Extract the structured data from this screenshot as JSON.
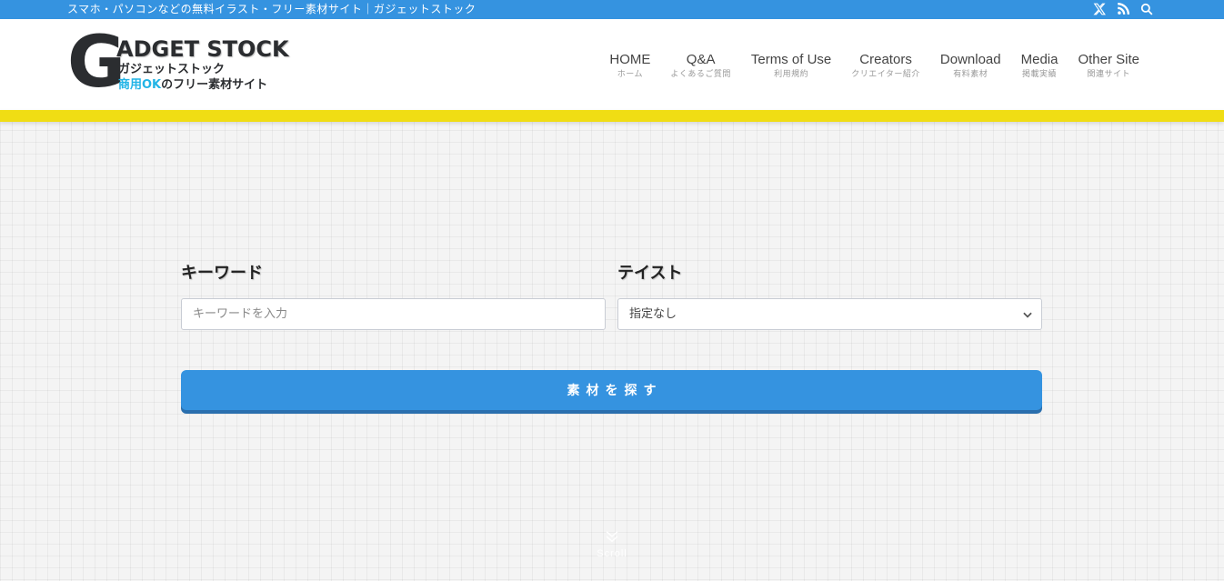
{
  "topbar": {
    "tagline": "スマホ・パソコンなどの無料イラスト・フリー素材サイト｜ガジェットストック",
    "icons": [
      "x-twitter-icon",
      "rss-icon",
      "search-icon"
    ]
  },
  "logo": {
    "initial": "G",
    "brand": "ADGET STOCK",
    "kana": "ガジェットストック",
    "sub_accent": "商用OK",
    "sub_rest": "のフリー素材サイト"
  },
  "nav": {
    "items": [
      {
        "en": "HOME",
        "ja": "ホーム"
      },
      {
        "en": "Q&A",
        "ja": "よくあるご質問"
      },
      {
        "en": "Terms of Use",
        "ja": "利用規約"
      },
      {
        "en": "Creators",
        "ja": "クリエイター紹介"
      },
      {
        "en": "Download",
        "ja": "有料素材"
      },
      {
        "en": "Media",
        "ja": "掲載実績"
      },
      {
        "en": "Other Site",
        "ja": "関連サイト"
      }
    ]
  },
  "search": {
    "keyword_label": "キーワード",
    "keyword_placeholder": "キーワードを入力",
    "keyword_value": "",
    "taste_label": "テイスト",
    "taste_selected": "指定なし",
    "submit_label": "素材を探す"
  },
  "scroll": {
    "label": "Scroll"
  },
  "colors": {
    "primary_blue": "#3593e0",
    "accent_yellow": "#f0dd14",
    "logo_accent": "#22b4e6"
  }
}
